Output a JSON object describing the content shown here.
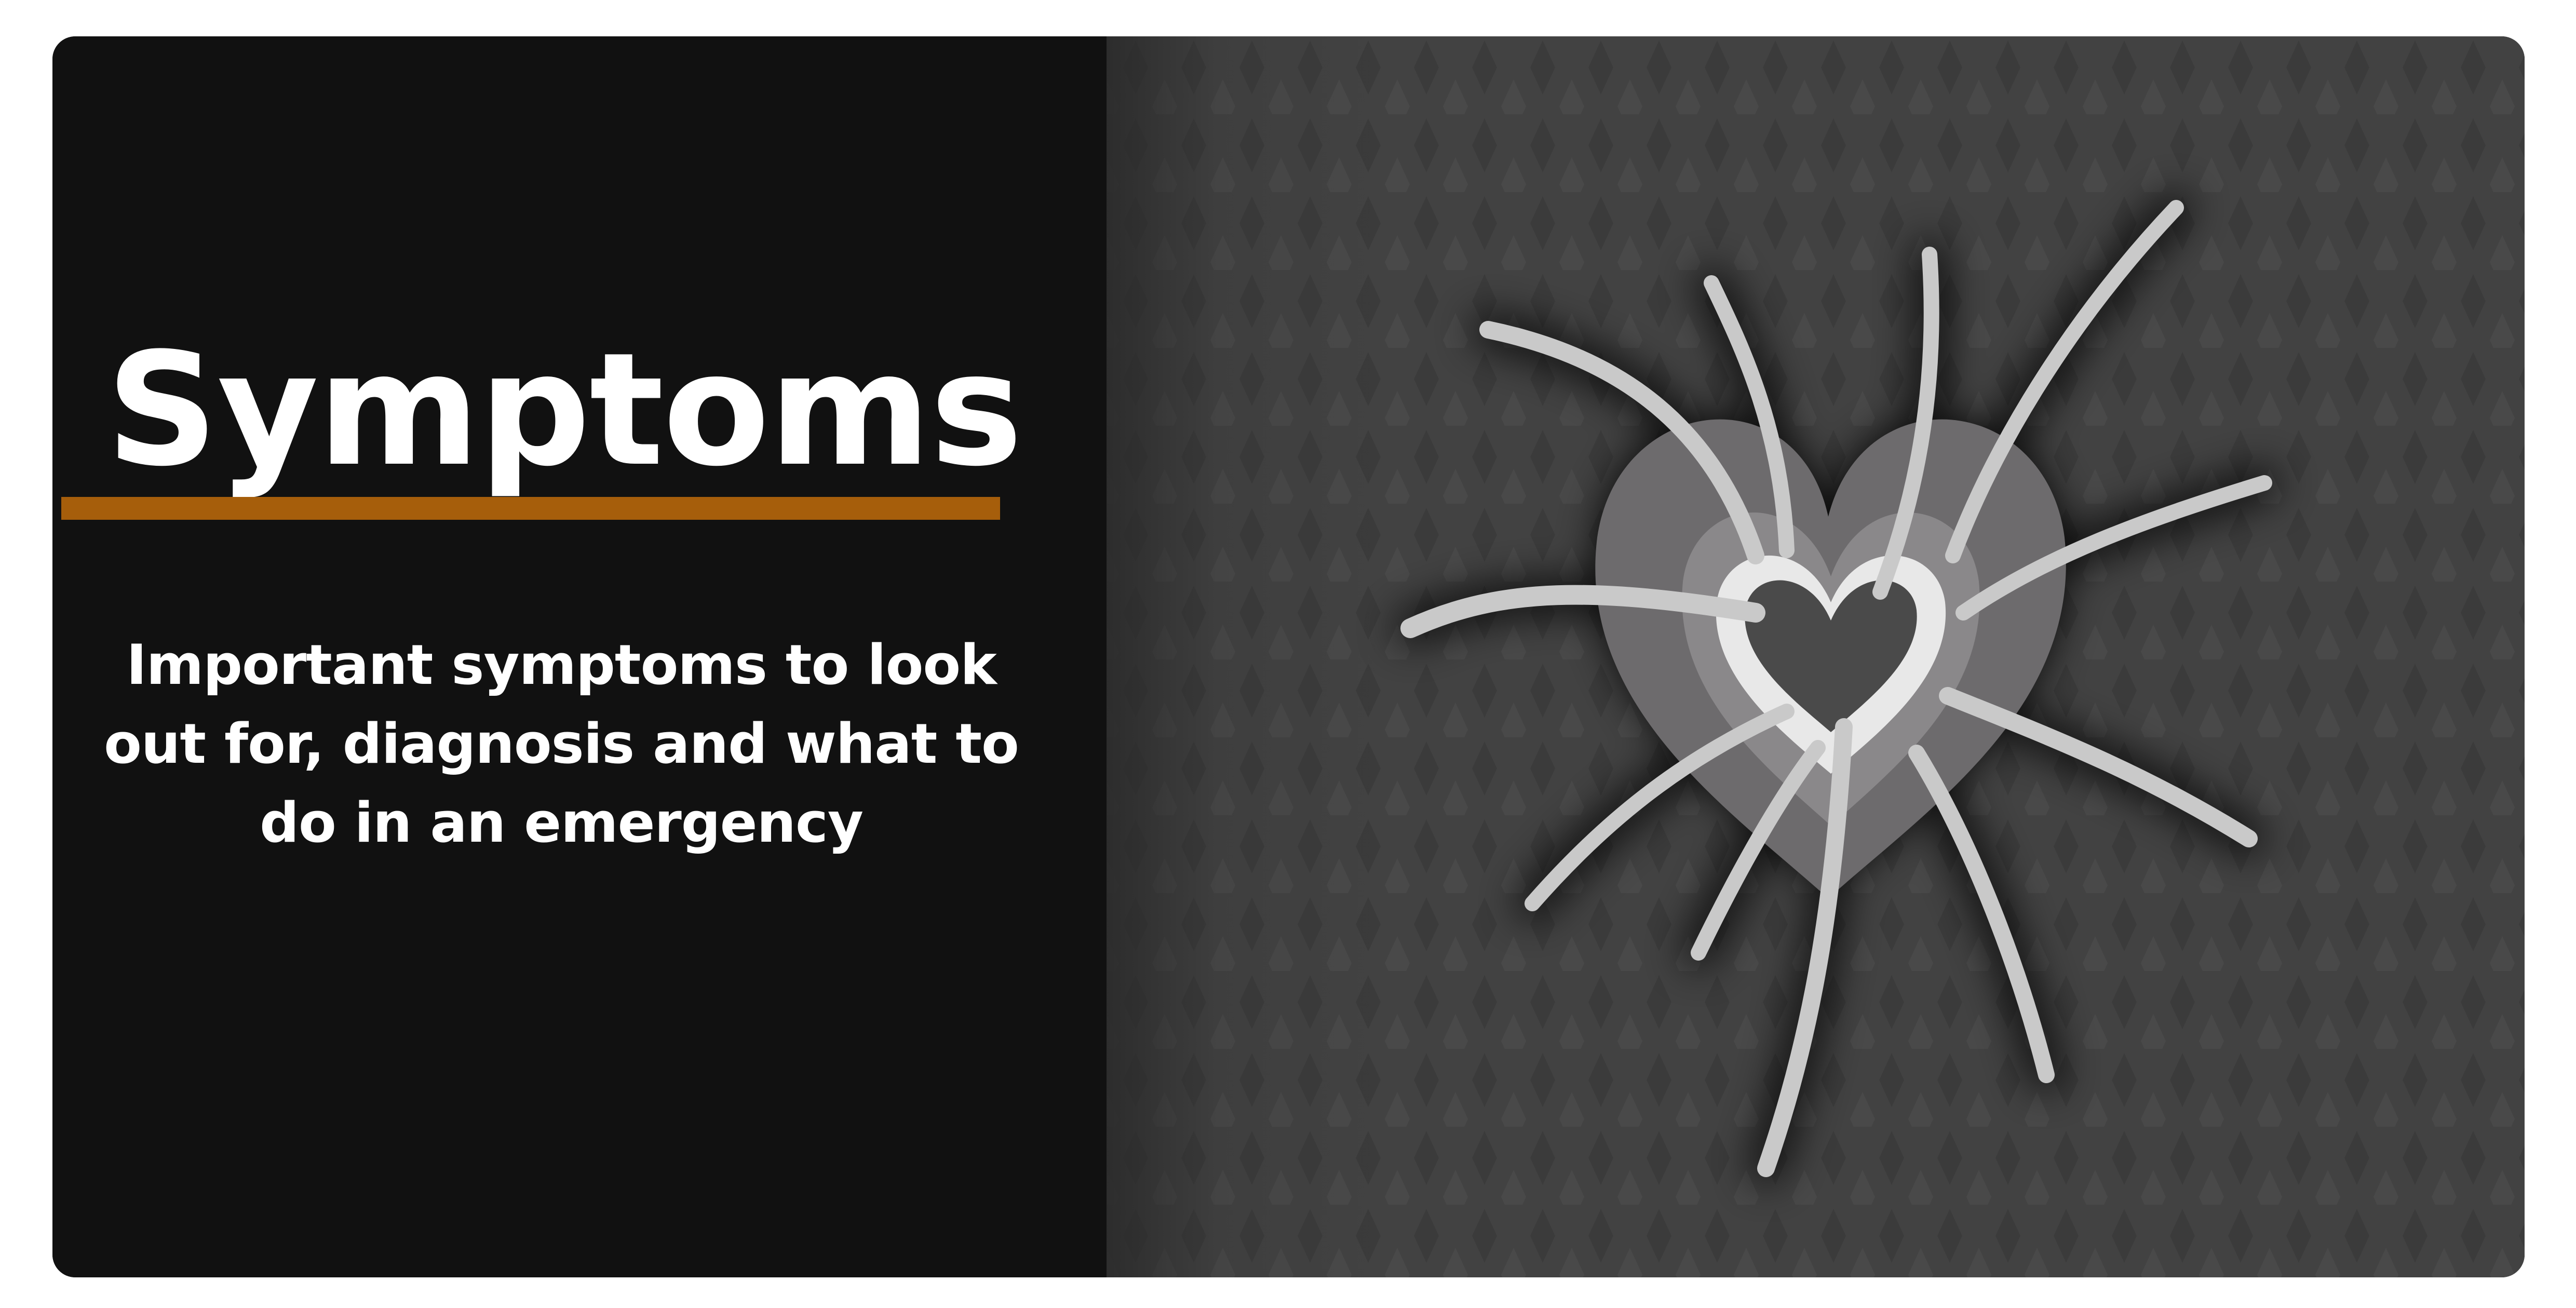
{
  "card": {
    "title": "Symptoms",
    "subtitle": "Important symptoms to look out for, diagnosis and what to do in an emergency"
  },
  "colors": {
    "panel_background": "#111111",
    "title_rule": "#a65e0b",
    "art_background": "#424242",
    "text": "#ffffff"
  },
  "illustration": {
    "icon": "heart-with-radiating-spikes-icon"
  }
}
